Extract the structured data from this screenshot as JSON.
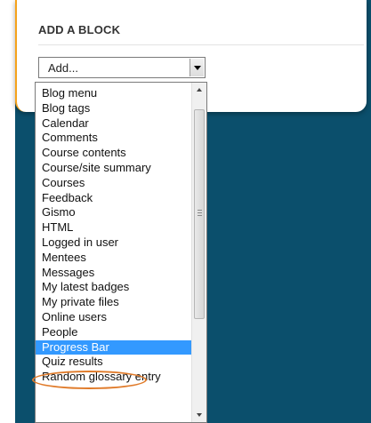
{
  "block": {
    "title": "ADD A BLOCK"
  },
  "select": {
    "value": "Add..."
  },
  "options": [
    "Blog menu",
    "Blog tags",
    "Calendar",
    "Comments",
    "Course contents",
    "Course/site summary",
    "Courses",
    "Feedback",
    "Gismo",
    "HTML",
    "Logged in user",
    "Mentees",
    "Messages",
    "My latest badges",
    "My private files",
    "Online users",
    "People",
    "Progress Bar",
    "Quiz results",
    "Random glossary entry"
  ],
  "selected_option": "Progress Bar",
  "colors": {
    "page_background": "#0b4f6c",
    "panel_accent": "#f5a21b",
    "selection": "#3399ff",
    "highlight_ring": "#e07b2a"
  },
  "icons": {
    "dropdown_arrow": "chevron-down-icon",
    "scroll_up": "scroll-up-arrow",
    "scroll_down": "scroll-down-arrow"
  }
}
